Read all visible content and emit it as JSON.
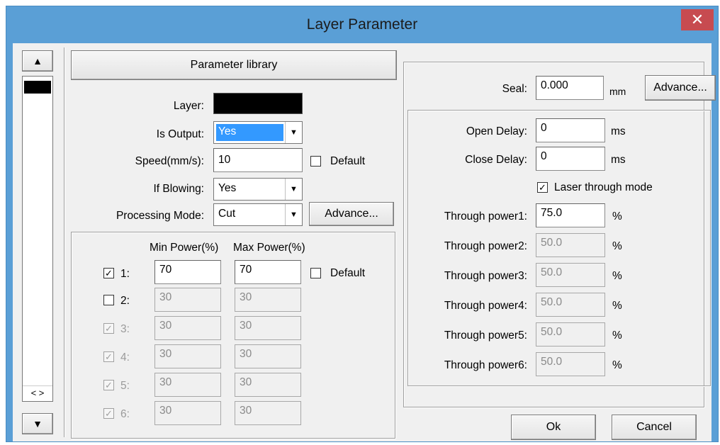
{
  "window": {
    "title": "Layer Parameter",
    "close_glyph": "✕"
  },
  "left": {
    "up_glyph": "▲",
    "down_glyph": "▼",
    "hscroll": "< >",
    "layer_color": "#000000"
  },
  "param_library": "Parameter library",
  "layer_label": "Layer:",
  "is_output": {
    "label": "Is Output:",
    "value": "Yes"
  },
  "speed": {
    "label": "Speed(mm/s):",
    "value": "10",
    "default_label": "Default"
  },
  "blowing": {
    "label": "If Blowing:",
    "value": "Yes"
  },
  "mode": {
    "label": "Processing Mode:",
    "value": "Cut",
    "advance": "Advance..."
  },
  "power": {
    "min_header": "Min Power(%)",
    "max_header": "Max Power(%)",
    "default_label": "Default",
    "rows": [
      {
        "label": "1:",
        "checked": true,
        "enabled": true,
        "min": "70",
        "max": "70"
      },
      {
        "label": "2:",
        "checked": false,
        "enabled": true,
        "min": "30",
        "max": "30"
      },
      {
        "label": "3:",
        "checked": true,
        "enabled": false,
        "min": "30",
        "max": "30"
      },
      {
        "label": "4:",
        "checked": true,
        "enabled": false,
        "min": "30",
        "max": "30"
      },
      {
        "label": "5:",
        "checked": true,
        "enabled": false,
        "min": "30",
        "max": "30"
      },
      {
        "label": "6:",
        "checked": true,
        "enabled": false,
        "min": "30",
        "max": "30"
      }
    ]
  },
  "seal": {
    "label": "Seal:",
    "value": "0.000",
    "unit": "mm",
    "advance": "Advance..."
  },
  "open_delay": {
    "label": "Open Delay:",
    "value": "0",
    "unit": "ms"
  },
  "close_delay": {
    "label": "Close Delay:",
    "value": "0",
    "unit": "ms"
  },
  "through_mode": {
    "label": "Laser through mode",
    "checked": true
  },
  "through": [
    {
      "label": "Through power1:",
      "value": "75.0",
      "unit": "%",
      "enabled": true
    },
    {
      "label": "Through power2:",
      "value": "50.0",
      "unit": "%",
      "enabled": false
    },
    {
      "label": "Through power3:",
      "value": "50.0",
      "unit": "%",
      "enabled": false
    },
    {
      "label": "Through power4:",
      "value": "50.0",
      "unit": "%",
      "enabled": false
    },
    {
      "label": "Through power5:",
      "value": "50.0",
      "unit": "%",
      "enabled": false
    },
    {
      "label": "Through power6:",
      "value": "50.0",
      "unit": "%",
      "enabled": false
    }
  ],
  "ok": "Ok",
  "cancel": "Cancel",
  "colors": {
    "titlebar": "#5a9fd6",
    "close": "#c74b50",
    "selection": "#3399ff",
    "client": "#f0f0f0"
  }
}
